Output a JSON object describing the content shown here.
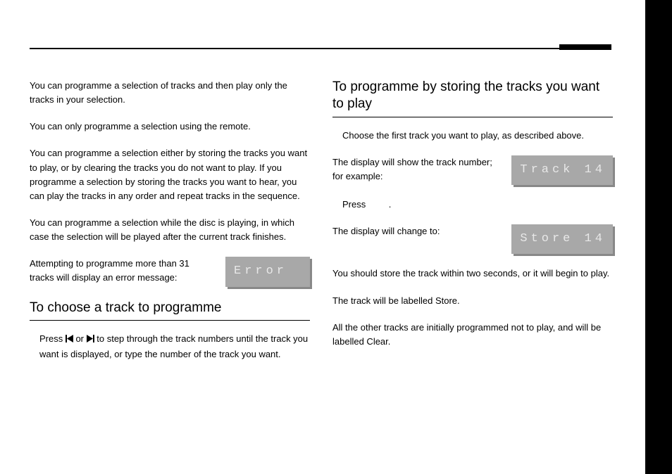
{
  "left": {
    "p1": "You can programme a selection of tracks and then play only the tracks in your selection.",
    "p2": "You can only programme a selection using the remote.",
    "p3": "You can programme a selection either by storing the tracks you want to play, or by clearing the tracks you do not want to play. If you programme a selection by storing the tracks you want to hear, you can play the tracks in any order and repeat tracks in the sequence.",
    "p4": "You can programme a selection while the disc is playing, in which case the selection will be played after the current track finishes.",
    "p5": "Attempting to programme more than 31 tracks will display an error message:",
    "lcd_error": "Error",
    "h2": "To choose a track to programme",
    "p6a": "Press ",
    "p6b": " or ",
    "p6c": " to step through the track numbers until the track you want is displayed, or type the number of the track you want."
  },
  "right": {
    "h2": "To programme by storing the tracks you want to play",
    "p1": "Choose the first track you want to play, as described above.",
    "p2": "The display will show the track number; for example:",
    "lcd_track": "Track 14",
    "p3a": "Press ",
    "p3b": ".",
    "p4": "The display will change to:",
    "lcd_store": "Store 14",
    "p5": "You should store the track within two seconds, or it will begin to play.",
    "p6": "The track will be labelled Store.",
    "p7": "All the other tracks are initially programmed not to play, and will be labelled Clear."
  }
}
